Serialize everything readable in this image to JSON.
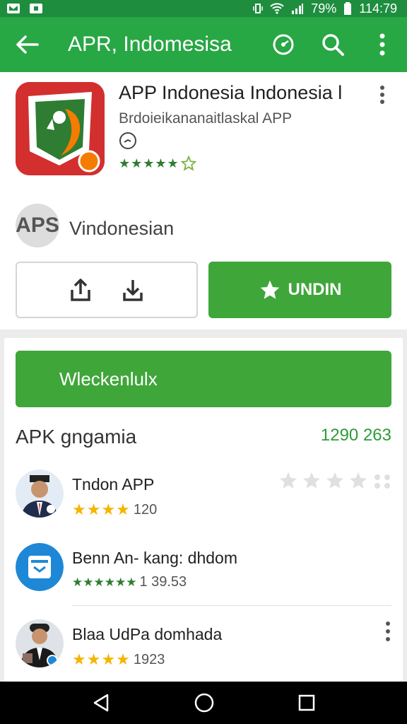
{
  "status_bar": {
    "battery": "79%",
    "time": "114:79"
  },
  "toolbar": {
    "title": "APR, Indomesisa"
  },
  "app": {
    "title": "APP Indonesia Indonesia l",
    "subtitle": "Brdoieikananaitlaskal APP",
    "rating_stars": "★★★★★",
    "developer_avatar": "APS",
    "developer": "Vindonesian",
    "install_label": "UNDIN"
  },
  "list": {
    "wide_button_label": "Wleckenlulx",
    "section_title": "APK gngamia",
    "section_count": "1290 263",
    "rows": [
      {
        "name": "Tndon APP",
        "stars": "★★★★",
        "count": "120"
      },
      {
        "name": "Benn An- kang: dhdom",
        "stars": "★★★★★★",
        "count": "1 39.53"
      },
      {
        "name": "Blaa UdPa domhada",
        "stars": "★★★★",
        "count": "1923"
      }
    ]
  },
  "colors": {
    "primary": "#28a745",
    "status": "#1e8e3e",
    "button": "#3fa63a",
    "star": "#f5b400"
  },
  "icons": [
    "photo-icon",
    "message-icon",
    "wifi-icon",
    "signal-icon",
    "battery-icon",
    "back-arrow-icon",
    "target-icon",
    "search-icon",
    "more-vert-icon",
    "clock-icon",
    "share-icon",
    "download-icon",
    "star-icon",
    "back-nav-icon",
    "home-nav-icon",
    "recents-nav-icon"
  ]
}
